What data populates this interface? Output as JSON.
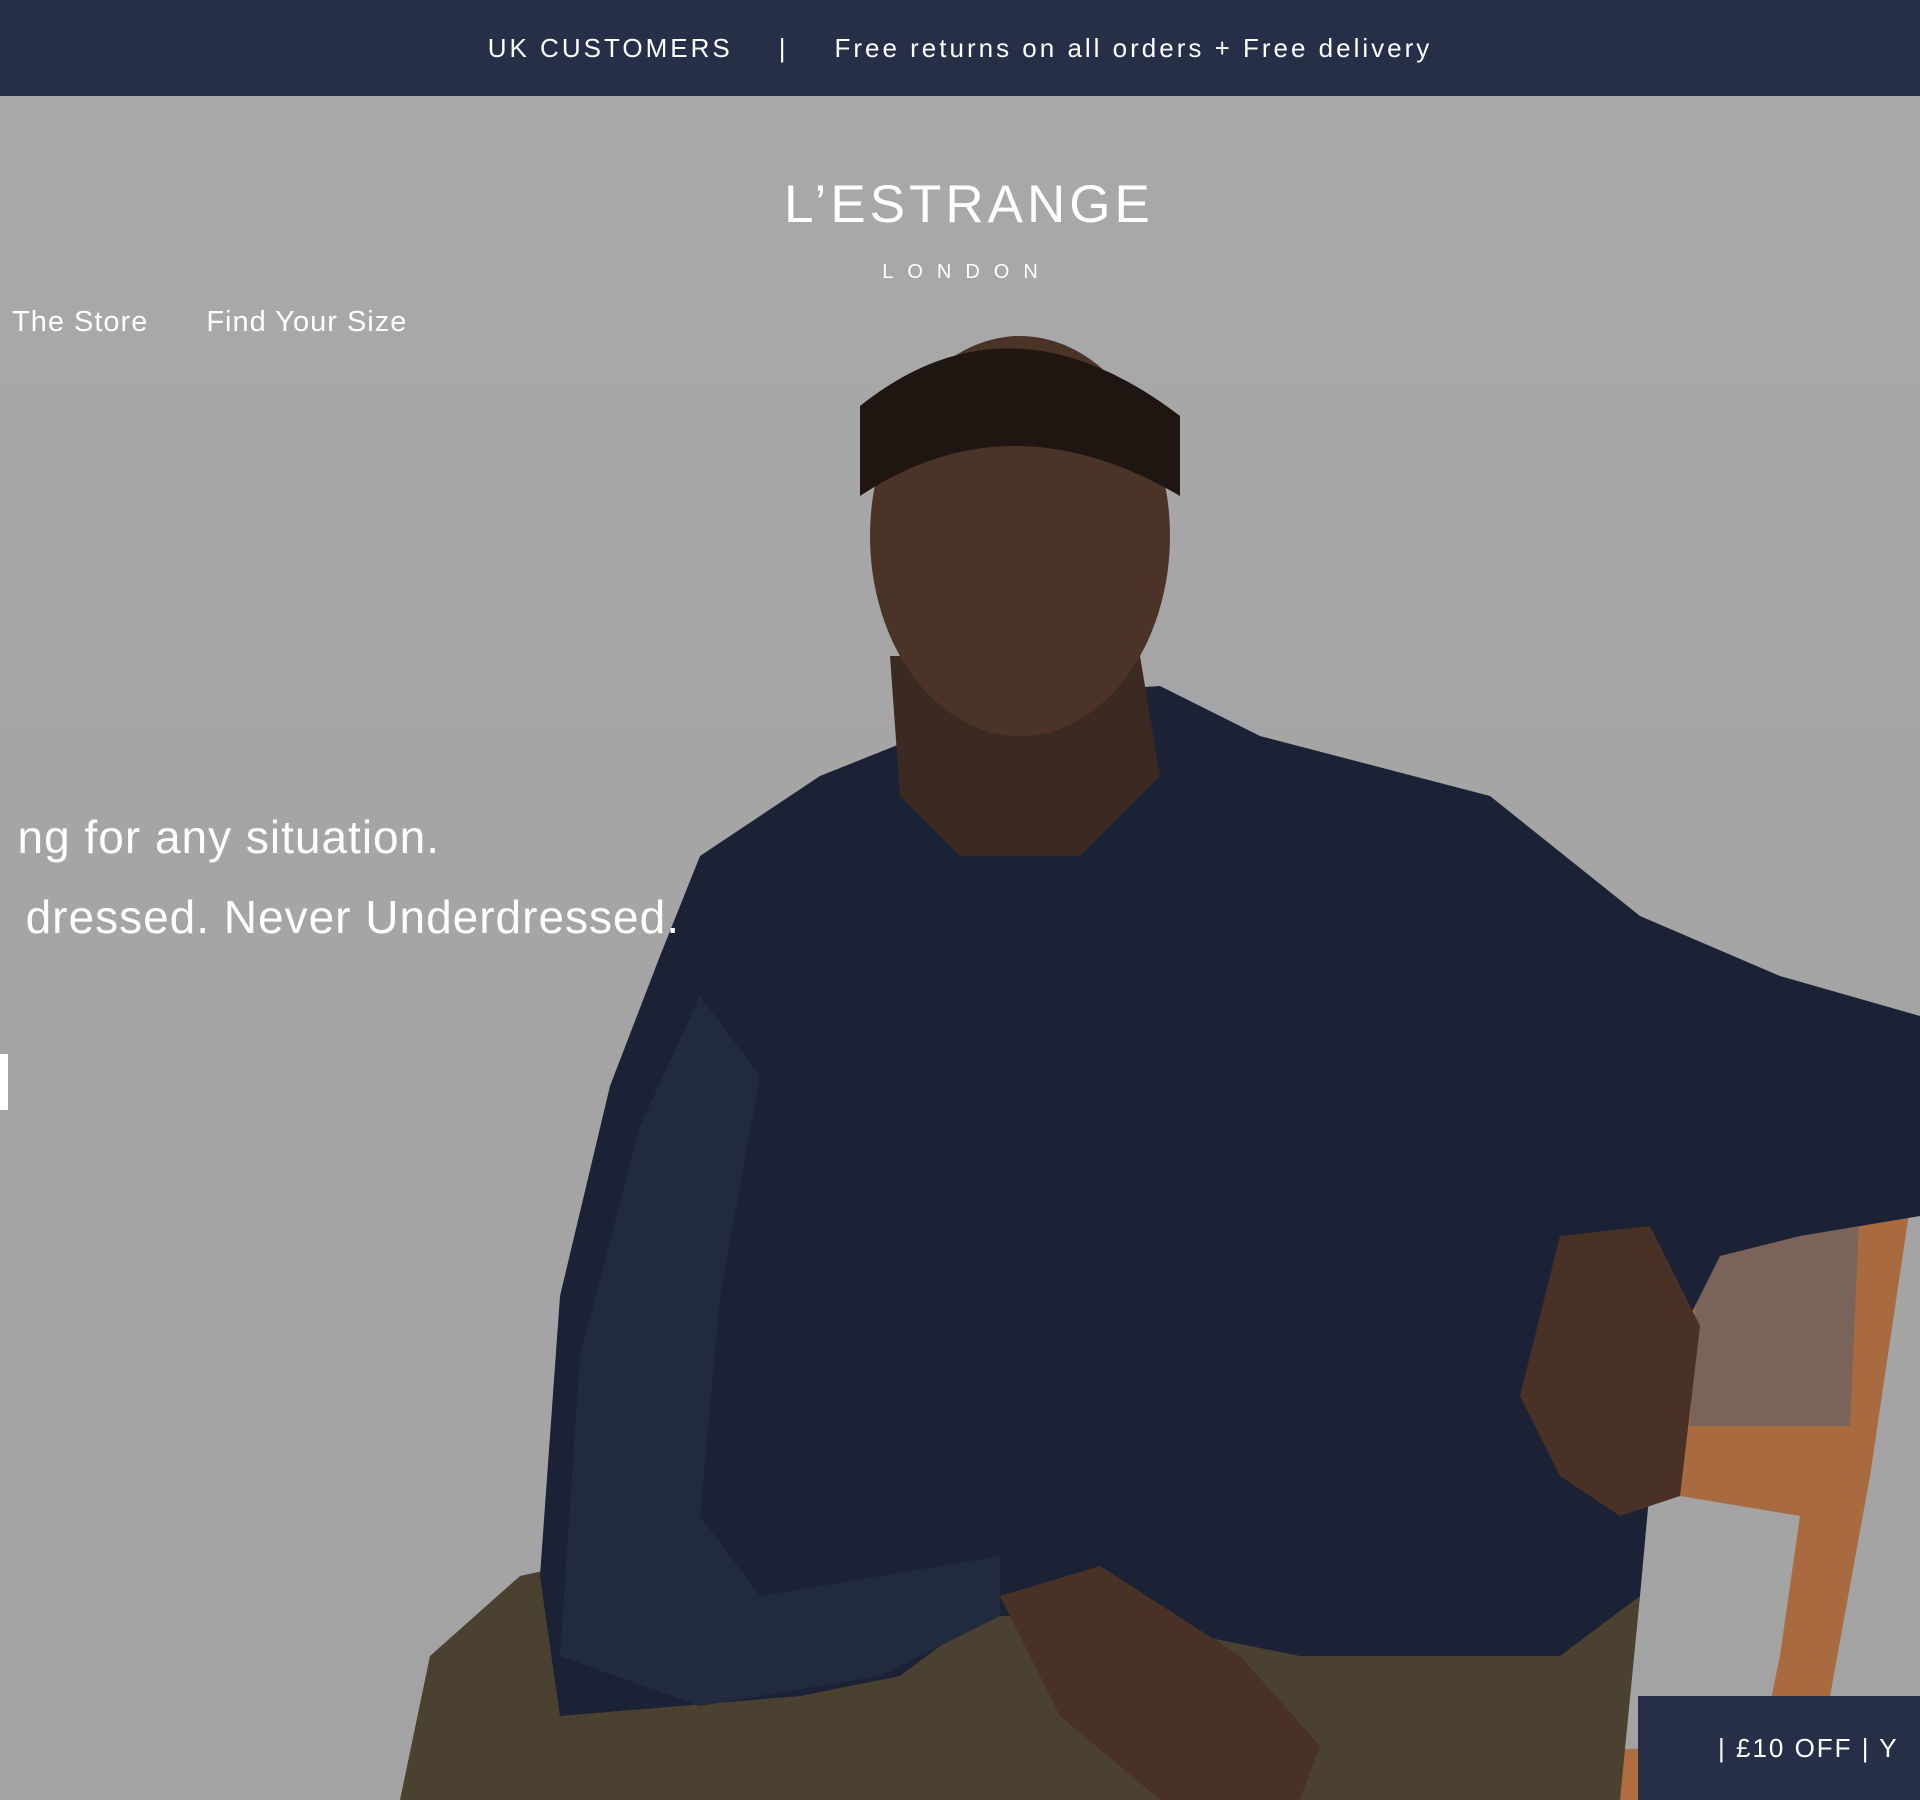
{
  "announcement": {
    "left": "UK CUSTOMERS",
    "separator": "|",
    "right": "Free returns on all orders + Free delivery"
  },
  "nav": {
    "items": [
      {
        "label": "The Store"
      },
      {
        "label": "Find Your Size"
      }
    ]
  },
  "logo": {
    "main": "L’ESTRANGE",
    "sub": "LONDON"
  },
  "hero": {
    "line1": "ng for any situation.",
    "line2": "dressed. Never Underdressed."
  },
  "discount_tab": {
    "label": "| £10 OFF |   Y"
  },
  "colors": {
    "bar_navy": "#262f47",
    "hero_bg": "#a7a7a7",
    "text": "#ffffff"
  }
}
